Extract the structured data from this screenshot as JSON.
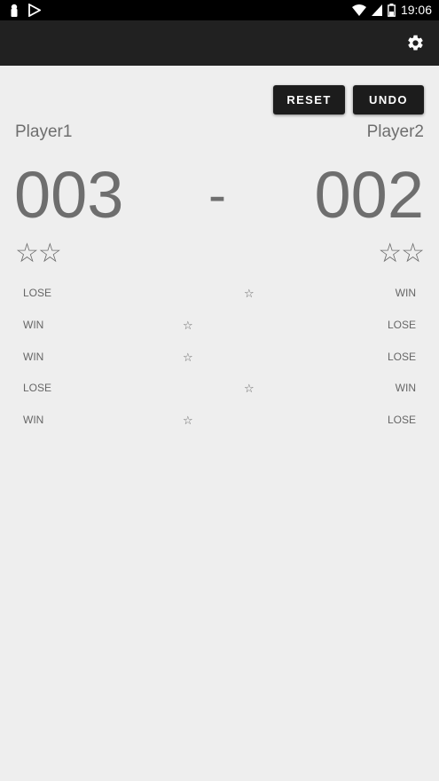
{
  "status_bar": {
    "time": "19:06",
    "icons": [
      "notification-icon",
      "play-store-icon",
      "wifi-icon",
      "signal-icon",
      "battery-icon"
    ]
  },
  "app_bar": {
    "settings_icon": "gear-icon"
  },
  "actions": {
    "reset_label": "RESET",
    "undo_label": "UNDO"
  },
  "players": {
    "p1_name": "Player1",
    "p2_name": "Player2",
    "p1_score": "003",
    "p2_score": "002",
    "separator": "-",
    "p1_stars": "☆☆",
    "p2_stars": "☆☆"
  },
  "history": [
    {
      "left": "LOSE",
      "right": "WIN",
      "star": "☆",
      "star_side": "right"
    },
    {
      "left": "WIN",
      "right": "LOSE",
      "star": "☆",
      "star_side": "left"
    },
    {
      "left": "WIN",
      "right": "LOSE",
      "star": "☆",
      "star_side": "left"
    },
    {
      "left": "LOSE",
      "right": "WIN",
      "star": "☆",
      "star_side": "right"
    },
    {
      "left": "WIN",
      "right": "LOSE",
      "star": "☆",
      "star_side": "left"
    }
  ],
  "colors": {
    "background": "#eeeeee",
    "appbar": "#212121",
    "text": "#6e6e6e",
    "button": "#1c1c1c"
  }
}
